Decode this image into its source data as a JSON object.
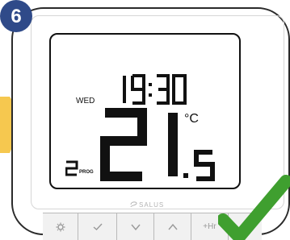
{
  "step": {
    "number": "6"
  },
  "display": {
    "day": "WED",
    "time": "19:30",
    "temperature_integer": "21",
    "temperature_decimal": "5",
    "unit": "°C",
    "program_number": "2",
    "program_label": "PROG"
  },
  "brand": {
    "logo_text": "SALUS"
  },
  "buttons": [
    {
      "icon": "gear-icon"
    },
    {
      "icon": "checkmark-icon"
    },
    {
      "icon": "chevron-down-icon"
    },
    {
      "icon": "chevron-up-icon"
    },
    {
      "label": "+Hr"
    },
    {
      "icon": "unknown"
    }
  ],
  "colors": {
    "badge": "#2f4a89",
    "arrow": "#f6c84f",
    "check": "#3f9f2f"
  }
}
